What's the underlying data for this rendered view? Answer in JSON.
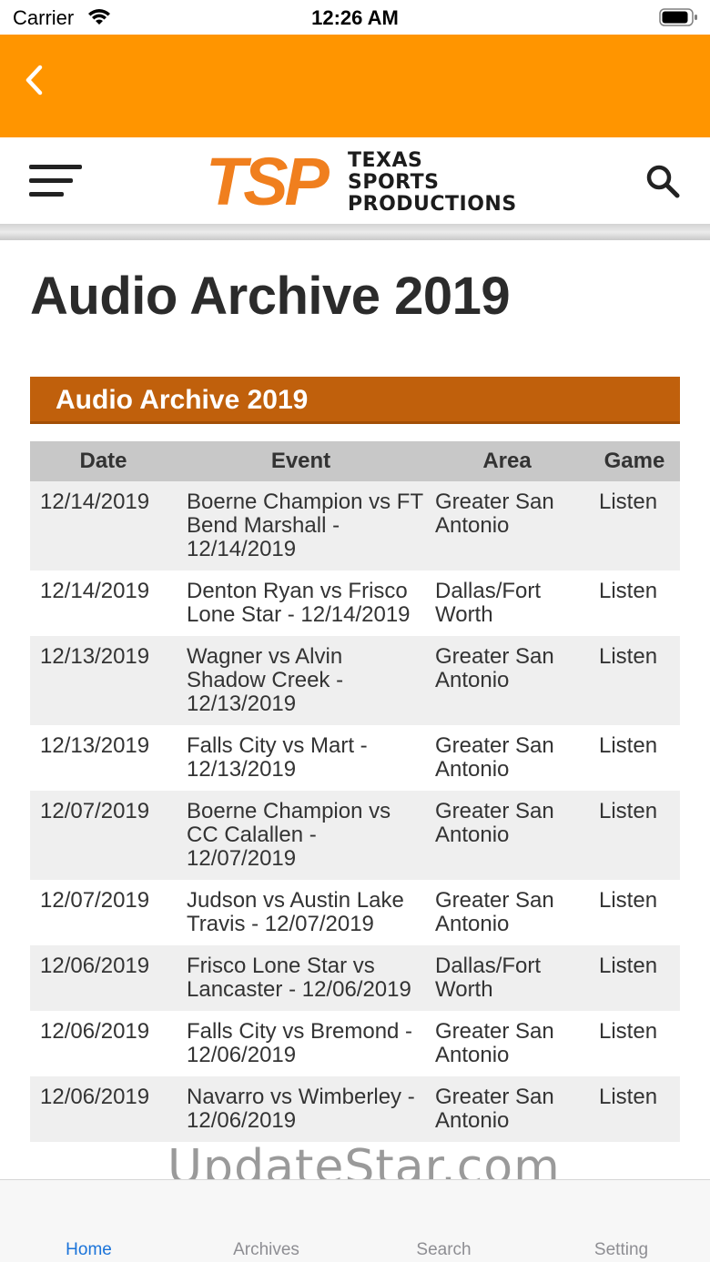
{
  "status_bar": {
    "carrier": "Carrier",
    "time": "12:26 AM"
  },
  "site": {
    "logo_letters": "TSP",
    "logo_line1": "TEXAS",
    "logo_line2": "SPORTS",
    "logo_line3": "PRODUCTIONS"
  },
  "page": {
    "title": "Audio Archive 2019",
    "section_title": "Audio Archive 2019"
  },
  "table": {
    "headers": [
      "Date",
      "Event",
      "Area",
      "Game"
    ],
    "rows": [
      {
        "date": "12/14/2019",
        "event": "Boerne Champion vs FT Bend Marshall - 12/14/2019",
        "area": "Greater San Antonio",
        "game": "Listen"
      },
      {
        "date": "12/14/2019",
        "event": "Denton Ryan vs Frisco Lone Star - 12/14/2019",
        "area": "Dallas/Fort Worth",
        "game": "Listen"
      },
      {
        "date": "12/13/2019",
        "event": "Wagner vs Alvin Shadow Creek - 12/13/2019",
        "area": "Greater San Antonio",
        "game": "Listen"
      },
      {
        "date": "12/13/2019",
        "event": "Falls City vs Mart - 12/13/2019",
        "area": "Greater San Antonio",
        "game": "Listen"
      },
      {
        "date": "12/07/2019",
        "event": "Boerne Champion vs CC Calallen - 12/07/2019",
        "area": "Greater San Antonio",
        "game": "Listen"
      },
      {
        "date": "12/07/2019",
        "event": "Judson vs Austin Lake Travis - 12/07/2019",
        "area": "Greater San Antonio",
        "game": "Listen"
      },
      {
        "date": "12/06/2019",
        "event": "Frisco Lone Star vs Lancaster - 12/06/2019",
        "area": "Dallas/Fort Worth",
        "game": "Listen"
      },
      {
        "date": "12/06/2019",
        "event": "Falls City vs Bremond - 12/06/2019",
        "area": "Greater San Antonio",
        "game": "Listen"
      },
      {
        "date": "12/06/2019",
        "event": "Navarro vs Wimberley - 12/06/2019",
        "area": "Greater San Antonio",
        "game": "Listen"
      }
    ]
  },
  "watermark": "UpdateStar.com",
  "tabs": [
    {
      "label": "Home",
      "active": true
    },
    {
      "label": "Archives",
      "active": false
    },
    {
      "label": "Search",
      "active": false
    },
    {
      "label": "Setting",
      "active": false
    }
  ],
  "colors": {
    "nav": "#ff9500",
    "section": "#c0600c",
    "link": "#c8680f",
    "tab_active": "#1a73d9"
  }
}
